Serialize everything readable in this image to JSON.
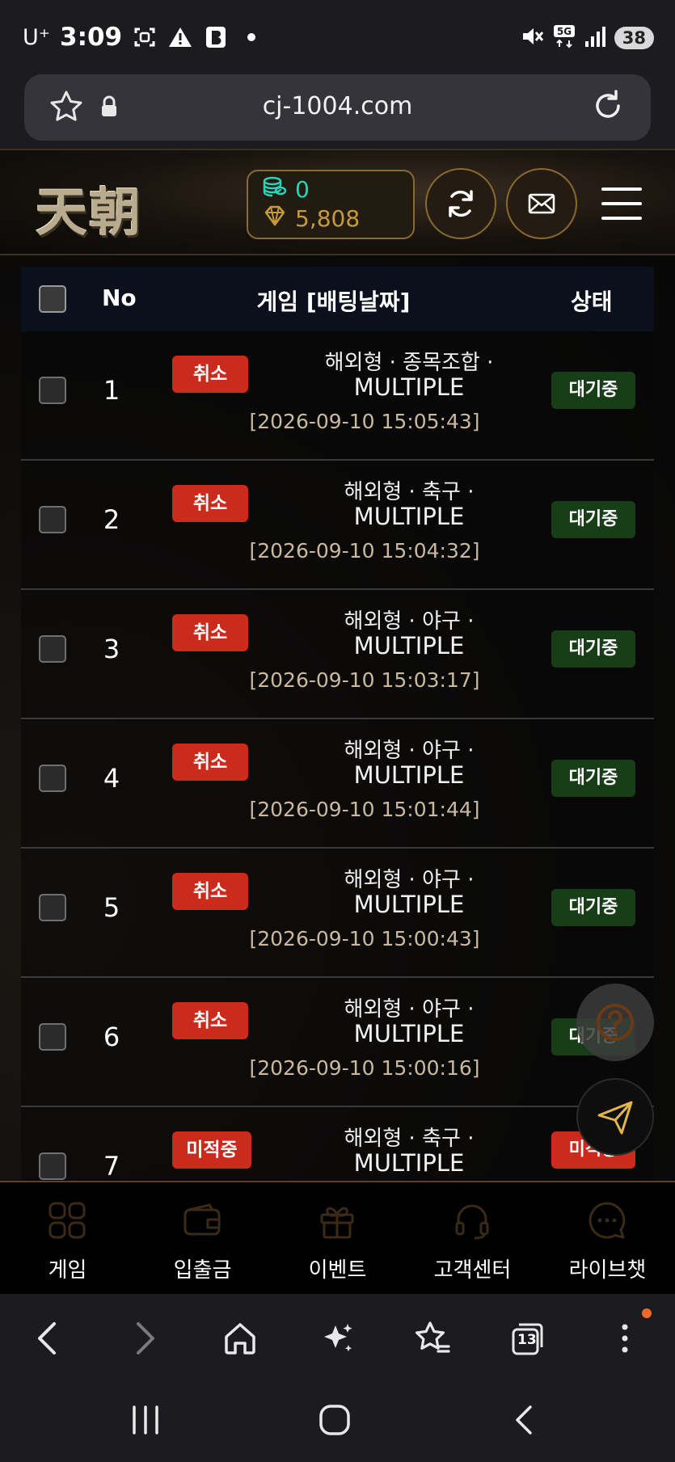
{
  "status_bar": {
    "carrier": "U⁺",
    "time": "3:09",
    "network": "5G",
    "battery": "38"
  },
  "browser": {
    "url": "cj-1004.com"
  },
  "header": {
    "logo_text": "天朝",
    "balance_coins": "0",
    "balance_points": "5,808"
  },
  "table": {
    "columns": [
      "No",
      "게임 [배팅날짜]",
      "상태"
    ],
    "rows": [
      {
        "no": "1",
        "action": "취소",
        "line1": "해외형 · 종목조합 ·",
        "line2": "MULTIPLE",
        "date": "[2026-09-10 15:05:43]",
        "status": "대기중"
      },
      {
        "no": "2",
        "action": "취소",
        "line1": "해외형 · 축구 ·",
        "line2": "MULTIPLE",
        "date": "[2026-09-10 15:04:32]",
        "status": "대기중"
      },
      {
        "no": "3",
        "action": "취소",
        "line1": "해외형 · 야구 ·",
        "line2": "MULTIPLE",
        "date": "[2026-09-10 15:03:17]",
        "status": "대기중"
      },
      {
        "no": "4",
        "action": "취소",
        "line1": "해외형 · 야구 ·",
        "line2": "MULTIPLE",
        "date": "[2026-09-10 15:01:44]",
        "status": "대기중"
      },
      {
        "no": "5",
        "action": "취소",
        "line1": "해외형 · 야구 ·",
        "line2": "MULTIPLE",
        "date": "[2026-09-10 15:00:43]",
        "status": "대기중"
      },
      {
        "no": "6",
        "action": "취소",
        "line1": "해외형 · 야구 ·",
        "line2": "MULTIPLE",
        "date": "[2026-09-10 15:00:16]",
        "status": "대기중"
      },
      {
        "no": "7",
        "action": "미적중",
        "line1": "해외형 · 축구 ·",
        "line2": "MULTIPLE",
        "date": "",
        "status": "미적중"
      }
    ]
  },
  "site_nav": [
    {
      "label": "게임",
      "icon": "grid-icon"
    },
    {
      "label": "입출금",
      "icon": "wallet-icon"
    },
    {
      "label": "이벤트",
      "icon": "gift-icon"
    },
    {
      "label": "고객센터",
      "icon": "headset-icon"
    },
    {
      "label": "라이브챗",
      "icon": "chat-icon"
    }
  ],
  "browser_nav": {
    "tab_count": "13"
  },
  "colors": {
    "accent_gold": "#8b6a2f",
    "cancel_red": "#cc2a1c",
    "waiting_green": "#183e17",
    "coin_teal": "#2ed0b6"
  }
}
